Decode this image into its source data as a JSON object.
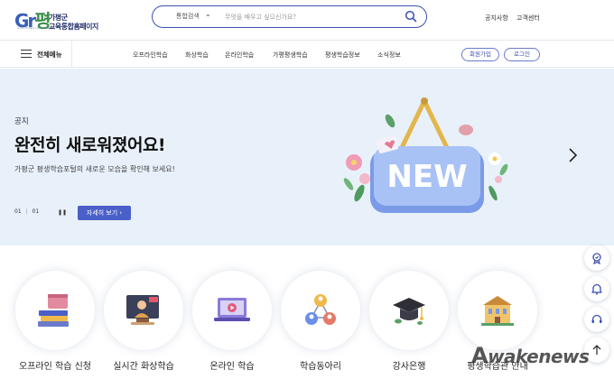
{
  "header": {
    "logo_mark": "Gr",
    "logo_mark_p": "평",
    "logo_sub": "GAPYEONG LEARNING",
    "logo_line1": "가평군",
    "logo_line2": "교육통합홈페이지",
    "search": {
      "category": "통합검색",
      "placeholder": "무엇을 배우고 싶으신가요?"
    },
    "links": [
      "공지사항",
      "고객센터"
    ]
  },
  "nav": {
    "menu_all": "전체메뉴",
    "items": [
      "오프라인학습",
      "화상학습",
      "온라인학습",
      "가평평생학습",
      "평생학습정보",
      "소식정보"
    ],
    "signup": "회원가입",
    "login": "로그인"
  },
  "hero": {
    "eyebrow": "공지",
    "title": "완전히 새로워졌어요!",
    "description": "가평군 평생학습포털의 새로운 모습을 확인해 보세요!",
    "pager_current": "01",
    "pager_total": "01",
    "detail_button": "자세히 보기",
    "sign_text": "NEW"
  },
  "services": [
    {
      "label": "오프라인 학습 신청",
      "icon": "books-calendar-icon"
    },
    {
      "label": "실시간 화상학습",
      "icon": "live-video-icon"
    },
    {
      "label": "온라인 학습",
      "icon": "laptop-play-icon"
    },
    {
      "label": "학습동아리",
      "icon": "people-network-icon"
    },
    {
      "label": "강사은행",
      "icon": "graduation-cap-icon"
    },
    {
      "label": "평생학습관 안내",
      "icon": "building-icon"
    }
  ],
  "watermark": "wakenews",
  "colors": {
    "brand": "#3c4fb0",
    "button": "#4a5fc8",
    "hero_bg": "#e8f1fa",
    "sign": "#7b9be8"
  }
}
